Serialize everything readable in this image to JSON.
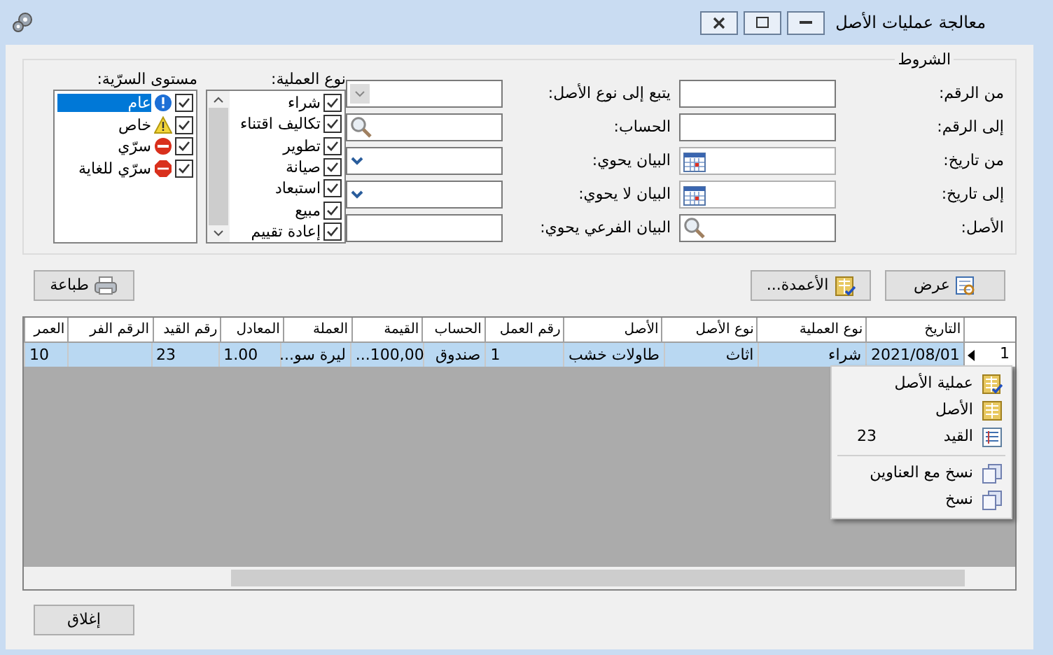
{
  "window": {
    "title": "معالجة عمليات الأصل"
  },
  "conditions": {
    "title": "الشروط",
    "column_1": [
      {
        "label": "من الرقم:",
        "kind": "text"
      },
      {
        "label": "إلى الرقم:",
        "kind": "text"
      },
      {
        "label": "من تاريخ:",
        "kind": "date"
      },
      {
        "label": "إلى تاريخ:",
        "kind": "date"
      },
      {
        "label": "الأصل:",
        "kind": "search"
      }
    ],
    "column_2": [
      {
        "label": "يتبع إلى نوع الأصل:",
        "kind": "combo"
      },
      {
        "label": "الحساب:",
        "kind": "search"
      },
      {
        "label": "البيان يحوي:",
        "kind": "dropdown"
      },
      {
        "label": "البيان لا يحوي:",
        "kind": "dropdown"
      },
      {
        "label": "البيان الفرعي يحوي:",
        "kind": "text"
      }
    ],
    "operation_type": {
      "label": "نوع العملية:",
      "items": [
        {
          "label": "شراء",
          "checked": true
        },
        {
          "label": "تكاليف اقتناء",
          "checked": true
        },
        {
          "label": "تطوير",
          "checked": true
        },
        {
          "label": "صيانة",
          "checked": true
        },
        {
          "label": "استبعاد",
          "checked": true
        },
        {
          "label": "مبيع",
          "checked": true
        },
        {
          "label": "إعادة تقييم",
          "checked": true
        }
      ]
    },
    "security_level": {
      "label": "مستوى السرّية:",
      "items": [
        {
          "label": "عام",
          "checked": true,
          "selected": true,
          "kind": "info"
        },
        {
          "label": "خاص",
          "checked": true,
          "selected": false,
          "kind": "warning"
        },
        {
          "label": "سرّي",
          "checked": true,
          "selected": false,
          "kind": "noentry"
        },
        {
          "label": "سرّي للغاية",
          "checked": true,
          "selected": false,
          "kind": "stop"
        }
      ]
    }
  },
  "buttons": {
    "show": "عرض",
    "columns": "الأعمدة...",
    "print": "طباعة",
    "close": "إغلاق"
  },
  "table": {
    "columns": [
      {
        "label": "التاريخ"
      },
      {
        "label": "نوع العملية"
      },
      {
        "label": "نوع الأصل"
      },
      {
        "label": "الأصل"
      },
      {
        "label": "رقم العمل"
      },
      {
        "label": "الحساب"
      },
      {
        "label": "القيمة"
      },
      {
        "label": "العملة"
      },
      {
        "label": "المعادل"
      },
      {
        "label": "رقم القيد"
      },
      {
        "label": "الرقم الفر"
      },
      {
        "label": "العمر"
      }
    ],
    "rows": [
      {
        "number": "1",
        "selected": true,
        "cells": [
          "2021/08/01",
          "شراء",
          "اثاث",
          "طاولات خشب",
          "1",
          "صندوق",
          "100,00...",
          "ليرة سو...",
          "1.00",
          "23",
          null,
          "10"
        ]
      }
    ]
  },
  "context_menu": {
    "items": [
      {
        "label": "عملية الأصل",
        "kind": "operation"
      },
      {
        "label": "الأصل",
        "kind": "asset"
      },
      {
        "label": "القيد",
        "kind": "entry",
        "value": "23"
      },
      {
        "kind": "separator"
      },
      {
        "label": "نسخ مع العناوين",
        "kind": "copy"
      },
      {
        "label": "نسخ",
        "kind": "copy"
      }
    ]
  }
}
